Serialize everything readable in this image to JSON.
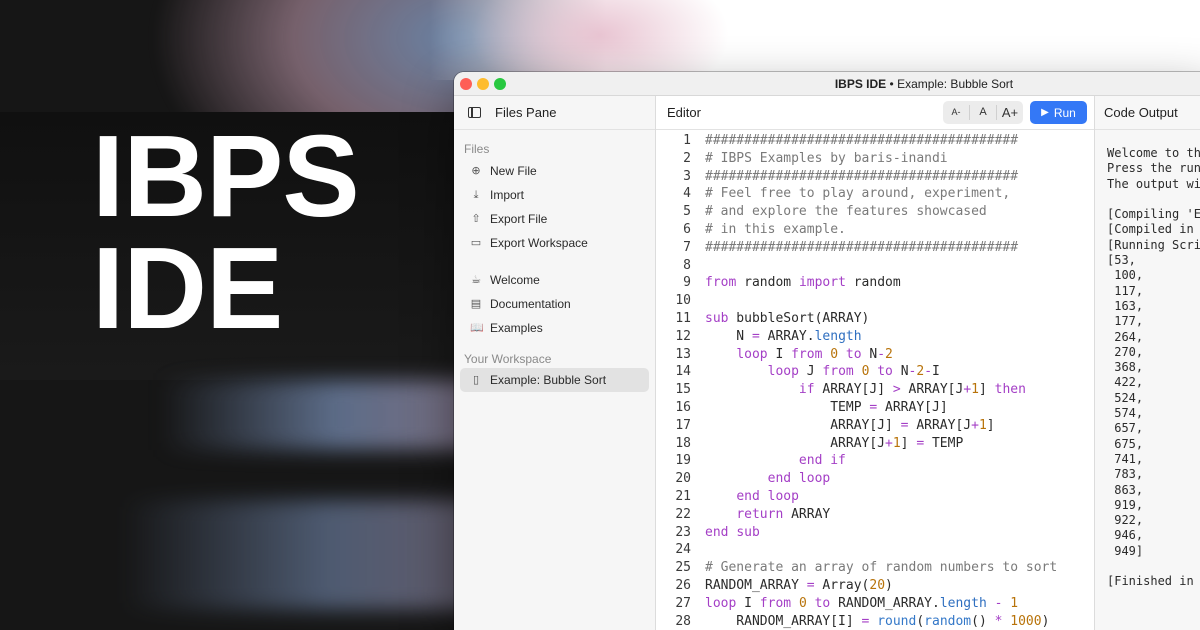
{
  "hero": {
    "line1": "IBPS",
    "line2": "IDE"
  },
  "window": {
    "title": "IBPS IDE",
    "separator": " • ",
    "subtitle": "Example: Bubble Sort"
  },
  "sidebar": {
    "pane_title": "Files Pane",
    "files_section": "Files",
    "file_items": [
      {
        "label": "New File",
        "icon": "plus-circle-icon"
      },
      {
        "label": "Import",
        "icon": "import-icon"
      },
      {
        "label": "Export File",
        "icon": "export-icon"
      },
      {
        "label": "Export Workspace",
        "icon": "export-workspace-icon"
      }
    ],
    "help_items": [
      {
        "label": "Welcome",
        "icon": "welcome-icon"
      },
      {
        "label": "Documentation",
        "icon": "documentation-icon"
      },
      {
        "label": "Examples",
        "icon": "book-icon"
      }
    ],
    "workspace_section": "Your Workspace",
    "workspace_items": [
      {
        "label": "Example: Bubble Sort",
        "icon": "document-icon",
        "active": true
      }
    ]
  },
  "editor": {
    "title": "Editor",
    "font_smaller": "A-",
    "font_reset": "A",
    "font_larger": "A+",
    "run_label": "Run",
    "lines": [
      "########################################",
      "# IBPS Examples by baris-inandi",
      "########################################",
      "# Feel free to play around, experiment,",
      "# and explore the features showcased",
      "# in this example.",
      "########################################",
      "",
      "from random import random",
      "",
      "sub bubbleSort(ARRAY)",
      "    N = ARRAY.length",
      "    loop I from 0 to N-2",
      "        loop J from 0 to N-2-I",
      "            if ARRAY[J] > ARRAY[J+1] then",
      "                TEMP = ARRAY[J]",
      "                ARRAY[J] = ARRAY[J+1]",
      "                ARRAY[J+1] = TEMP",
      "            end if",
      "        end loop",
      "    end loop",
      "    return ARRAY",
      "end sub",
      "",
      "# Generate an array of random numbers to sort",
      "RANDOM_ARRAY = Array(20)",
      "loop I from 0 to RANDOM_ARRAY.length - 1",
      "    RANDOM_ARRAY[I] = round(random() * 1000)"
    ]
  },
  "output": {
    "title": "Code Output",
    "lines": [
      "Welcome to th",
      "Press the run",
      "The output wi",
      "",
      "[Compiling 'E",
      "[Compiled in",
      "[Running Scri",
      "[53,",
      " 100,",
      " 117,",
      " 163,",
      " 177,",
      " 264,",
      " 270,",
      " 368,",
      " 422,",
      " 524,",
      " 574,",
      " 657,",
      " 675,",
      " 741,",
      " 783,",
      " 863,",
      " 919,",
      " 922,",
      " 946,",
      " 949]",
      "",
      "[Finished in"
    ]
  },
  "colors": {
    "accent": "#3478f6",
    "keyword": "#a43fc6",
    "number": "#b8730a",
    "function": "#3478c8",
    "comment": "#7a7a7a"
  }
}
